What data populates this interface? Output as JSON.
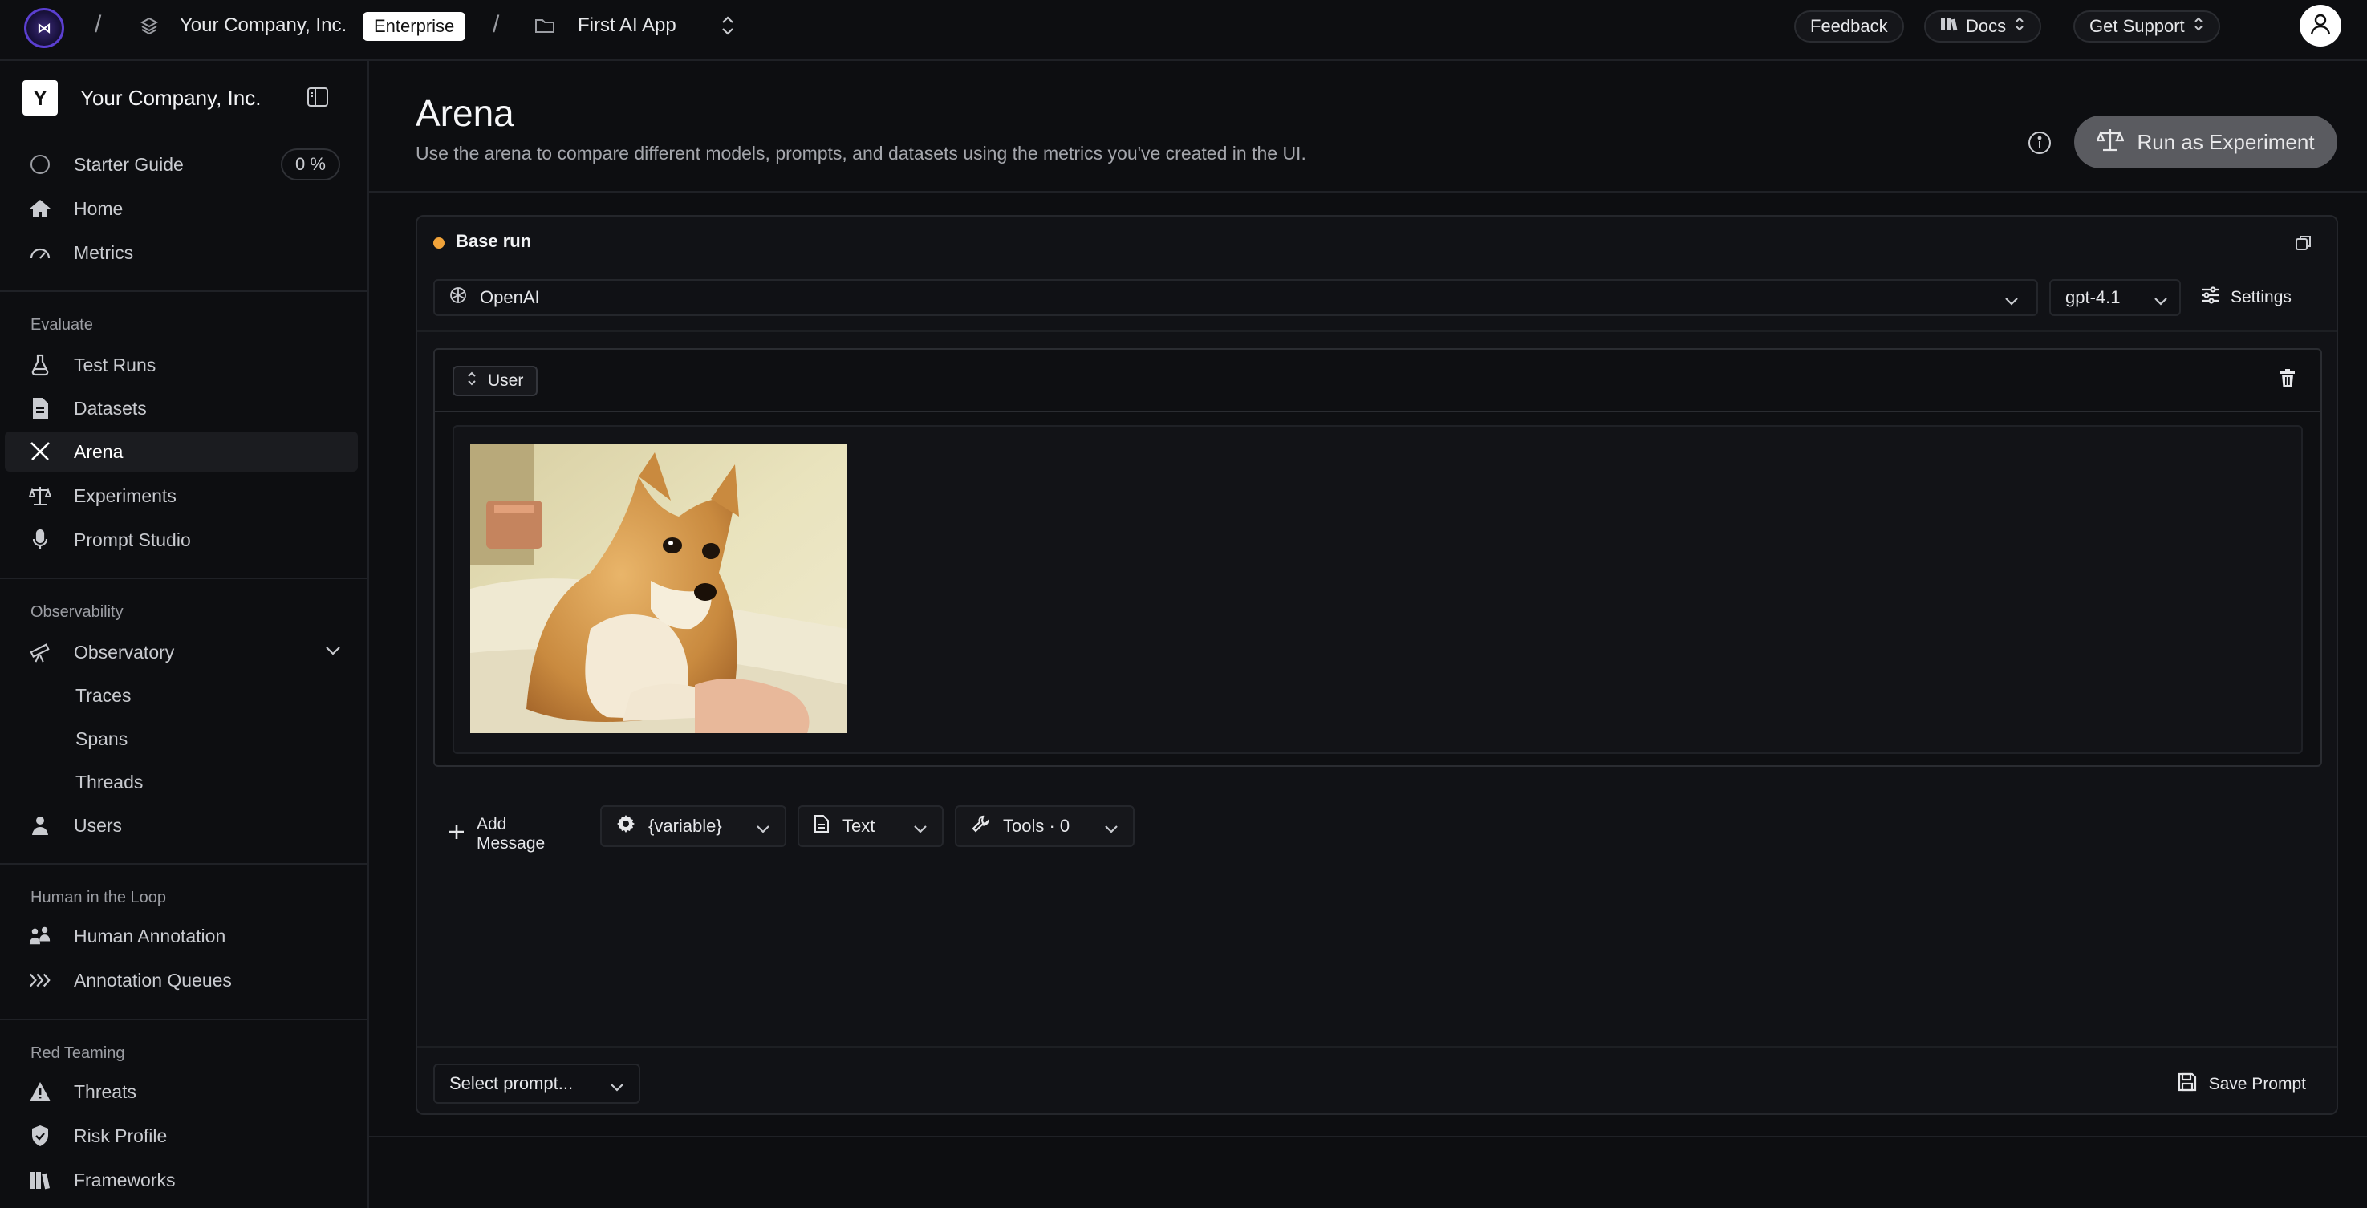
{
  "topbar": {
    "logo_text": "⋈",
    "org_name": "Your Company, Inc.",
    "plan_badge": "Enterprise",
    "project_name": "First AI App",
    "feedback_label": "Feedback",
    "docs_label": "Docs",
    "support_label": "Get Support",
    "separator": "/"
  },
  "sidebar": {
    "org_initial": "Y",
    "org_name": "Your Company, Inc.",
    "starter_guide": "Starter Guide",
    "starter_progress": "0 %",
    "home": "Home",
    "metrics": "Metrics",
    "section_evaluate": "Evaluate",
    "test_runs": "Test Runs",
    "datasets": "Datasets",
    "arena": "Arena",
    "experiments": "Experiments",
    "prompt_studio": "Prompt Studio",
    "section_observability": "Observability",
    "observatory": "Observatory",
    "traces": "Traces",
    "spans": "Spans",
    "threads": "Threads",
    "users": "Users",
    "section_hitl": "Human in the Loop",
    "human_annotation": "Human Annotation",
    "annotation_queues": "Annotation Queues",
    "section_red_teaming": "Red Teaming",
    "threats": "Threats",
    "risk_profile": "Risk Profile",
    "frameworks": "Frameworks"
  },
  "main": {
    "title": "Arena",
    "subtitle": "Use the arena to compare different models, prompts, and datasets using the metrics you've created in the UI.",
    "run_experiment_label": "Run as Experiment",
    "card": {
      "title": "Base run",
      "provider": "OpenAI",
      "model": "gpt-4.1",
      "settings_label": "Settings",
      "message_role": "User",
      "add_message_label": "Add Message",
      "variable_label": "{variable}",
      "text_label": "Text",
      "tools_label": "Tools · 0",
      "select_prompt_placeholder": "Select prompt...",
      "save_prompt_label": "Save Prompt"
    }
  },
  "colors": {
    "accent_dot": "#f1a33a",
    "run_button_bg": "#5a5b60",
    "background": "#0d0e11"
  }
}
